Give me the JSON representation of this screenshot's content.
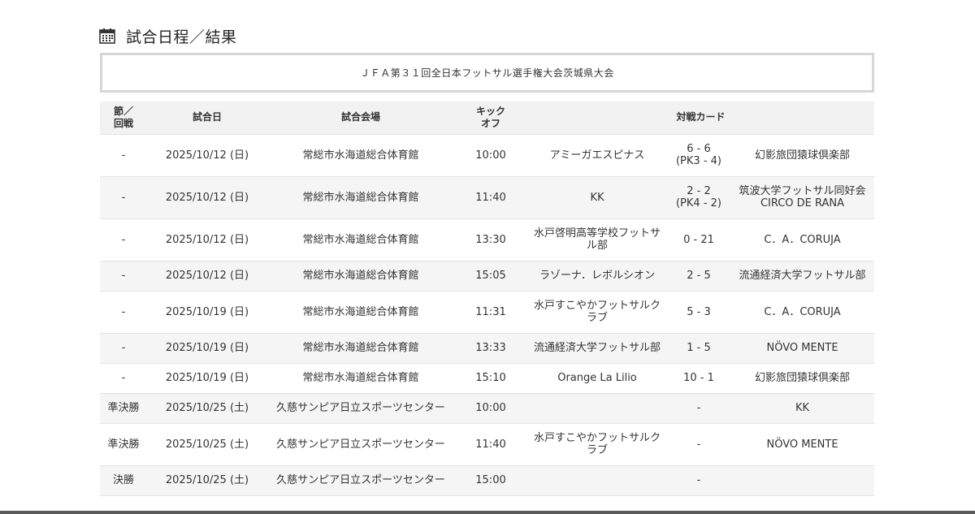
{
  "heading": {
    "icon": "calendar-icon",
    "title": "試合日程／結果"
  },
  "tournament_title": "ＪＦＡ第３１回全日本フットサル選手権大会茨城県大会",
  "table": {
    "headers": {
      "round_line1": "節／",
      "round_line2": "回戦",
      "date": "試合日",
      "venue": "試合会場",
      "kickoff_line1": "キック",
      "kickoff_line2": "オフ",
      "matchup": "対戦カード"
    },
    "rows": [
      {
        "round": "-",
        "date": "2025/10/12 (日)",
        "venue": "常総市水海道総合体育館",
        "time": "10:00",
        "home": "アミーガエスピナス",
        "score": "6 - 6",
        "pk": "(PK3 - 4)",
        "away": "幻影旅団猿球倶楽部"
      },
      {
        "round": "-",
        "date": "2025/10/12 (日)",
        "venue": "常総市水海道総合体育館",
        "time": "11:40",
        "home": "KK",
        "score": "2 - 2",
        "pk": "(PK4 - 2)",
        "away": "筑波大学フットサル同好会 CIRCO DE RANA"
      },
      {
        "round": "-",
        "date": "2025/10/12 (日)",
        "venue": "常総市水海道総合体育館",
        "time": "13:30",
        "home": "水戸啓明高等学校フットサル部",
        "score": "0 - 21",
        "pk": "",
        "away": "C．A．CORUJA"
      },
      {
        "round": "-",
        "date": "2025/10/12 (日)",
        "venue": "常総市水海道総合体育館",
        "time": "15:05",
        "home": "ラゾーナ．レボルシオン",
        "score": "2 - 5",
        "pk": "",
        "away": "流通経済大学フットサル部"
      },
      {
        "round": "-",
        "date": "2025/10/19 (日)",
        "venue": "常総市水海道総合体育館",
        "time": "11:31",
        "home": "水戸すこやかフットサルクラブ",
        "score": "5 - 3",
        "pk": "",
        "away": "C．A．CORUJA"
      },
      {
        "round": "-",
        "date": "2025/10/19 (日)",
        "venue": "常総市水海道総合体育館",
        "time": "13:33",
        "home": "流通経済大学フットサル部",
        "score": "1 - 5",
        "pk": "",
        "away": "NÖVO MENTE"
      },
      {
        "round": "-",
        "date": "2025/10/19 (日)",
        "venue": "常総市水海道総合体育館",
        "time": "15:10",
        "home": "Orange La Lilio",
        "score": "10 - 1",
        "pk": "",
        "away": "幻影旅団猿球倶楽部"
      },
      {
        "round": "準決勝",
        "date": "2025/10/25 (土)",
        "venue": "久慈サンピア日立スポーツセンター",
        "time": "10:00",
        "home": "",
        "score": "-",
        "pk": "",
        "away": "KK"
      },
      {
        "round": "準決勝",
        "date": "2025/10/25 (土)",
        "venue": "久慈サンピア日立スポーツセンター",
        "time": "11:40",
        "home": "水戸すこやかフットサルクラブ",
        "score": "-",
        "pk": "",
        "away": "NÖVO MENTE"
      },
      {
        "round": "決勝",
        "date": "2025/10/25 (土)",
        "venue": "久慈サンピア日立スポーツセンター",
        "time": "15:00",
        "home": "",
        "score": "-",
        "pk": "",
        "away": ""
      }
    ]
  },
  "colors": {
    "score_link": "#2a4f8c",
    "header_bg": "#f2f2f2",
    "stripe_bg": "#f5f5f5",
    "title_border": "#d6d6d6"
  }
}
